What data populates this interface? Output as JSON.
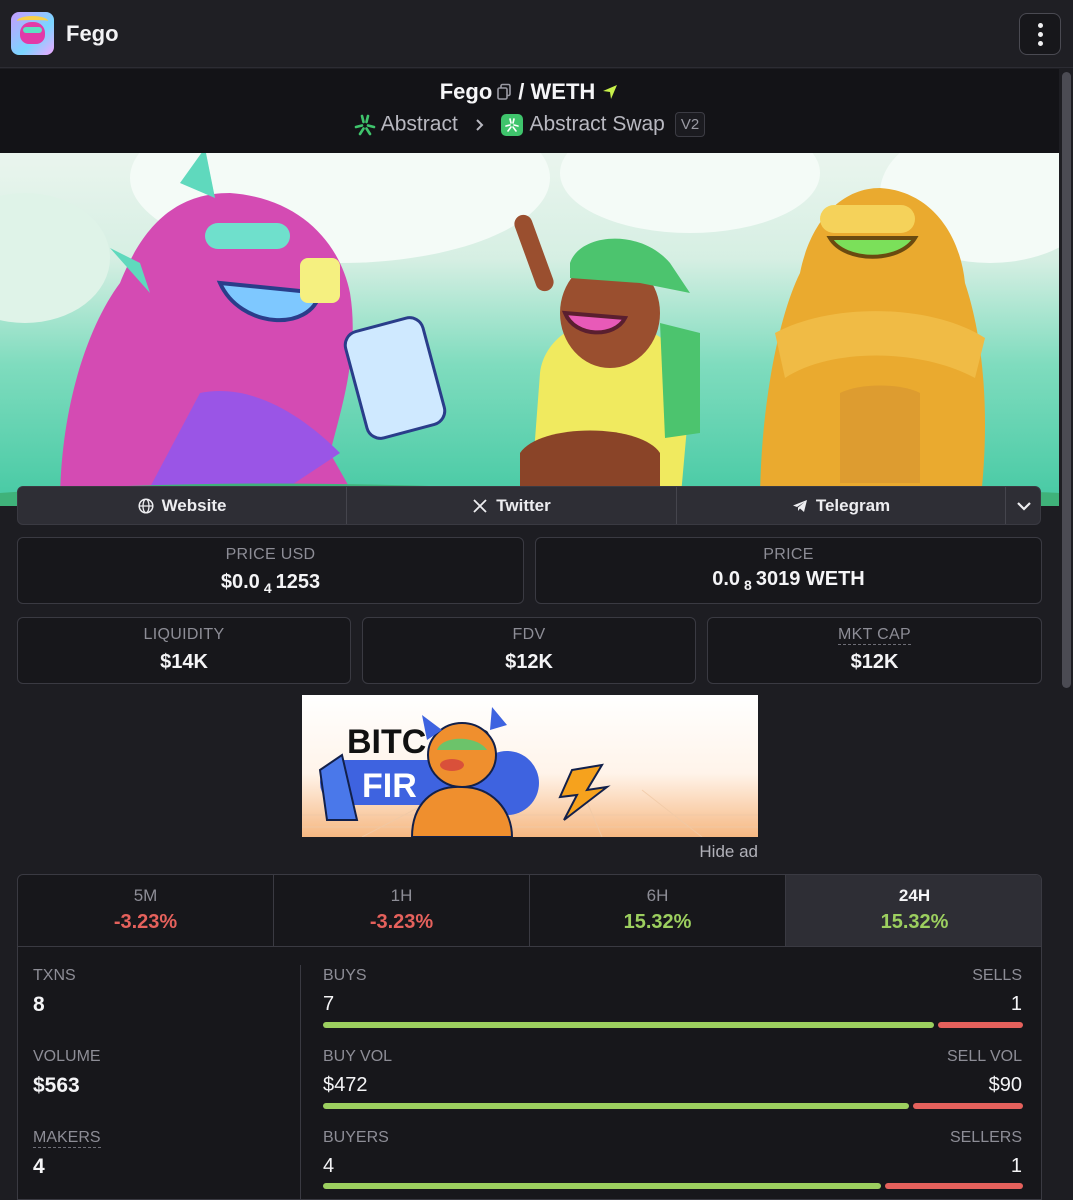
{
  "app": {
    "title": "Fego",
    "menu_icon": "vertical-dots-icon"
  },
  "pair": {
    "base": "Fego",
    "quote": "WETH",
    "separator": "/",
    "chain": "Abstract",
    "dex": "Abstract Swap",
    "version": "V2"
  },
  "links": {
    "website": "Website",
    "twitter": "Twitter",
    "telegram": "Telegram"
  },
  "prices": {
    "price_usd_label": "PRICE USD",
    "price_usd_prefix": "$0.0",
    "price_usd_zeros": "4",
    "price_usd_digits": "1253",
    "price_label": "PRICE",
    "price_prefix": "0.0",
    "price_zeros": "8",
    "price_digits": "3019 WETH"
  },
  "stats": {
    "liquidity_label": "LIQUIDITY",
    "liquidity": "$14K",
    "fdv_label": "FDV",
    "fdv": "$12K",
    "mktcap_label": "MKT CAP",
    "mktcap": "$12K"
  },
  "ad": {
    "hide_label": "Hide ad",
    "headline": "BITC  N'S",
    "word2": "FIR"
  },
  "timeframes": [
    {
      "label": "5M",
      "change": "-3.23%",
      "trend": "neg"
    },
    {
      "label": "1H",
      "change": "-3.23%",
      "trend": "neg"
    },
    {
      "label": "6H",
      "change": "15.32%",
      "trend": "pos"
    },
    {
      "label": "24H",
      "change": "15.32%",
      "trend": "pos",
      "active": true
    }
  ],
  "metrics": {
    "txns_label": "TXNS",
    "txns": "8",
    "volume_label": "VOLUME",
    "volume": "$563",
    "makers_label": "MAKERS",
    "makers": "4",
    "buys_label": "BUYS",
    "buys": "7",
    "sells_label": "SELLS",
    "sells": "1",
    "buy_vol_label": "BUY VOL",
    "buy_vol": "$472",
    "sell_vol_label": "SELL VOL",
    "sell_vol": "$90",
    "buyers_label": "BUYERS",
    "buyers": "4",
    "sellers_label": "SELLERS",
    "sellers": "1",
    "buys_share": 0.875,
    "buy_vol_share": 0.84,
    "buyers_share": 0.8
  },
  "colors": {
    "positive": "#9ccf5f",
    "negative": "#e5615c",
    "accent_green": "#3fc46c"
  }
}
